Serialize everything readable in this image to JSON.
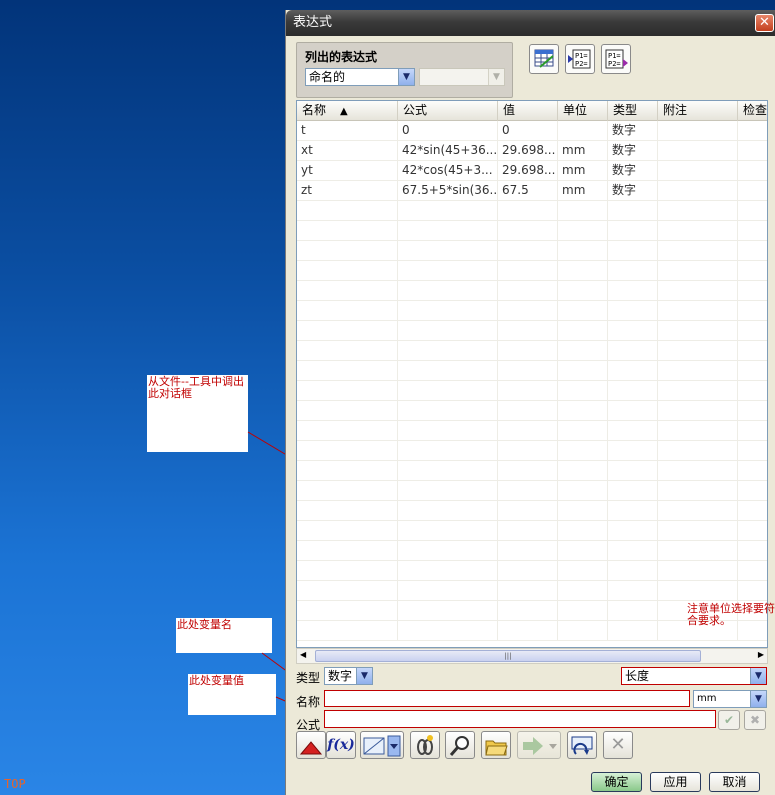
{
  "desktop": {
    "view_label": "TOP"
  },
  "annotations": {
    "dialog_source": "从文件--工具中调出此对话框",
    "var_name": "此处变量名",
    "var_value": "此处变量值",
    "unit_hint": "注意单位选择要符合要求。"
  },
  "dialog": {
    "title": "表达式",
    "close": "✕",
    "group_title": "列出的表达式",
    "list_filter": "命名的",
    "second_filter": "",
    "columns": [
      "名称",
      "公式",
      "值",
      "单位",
      "类型",
      "附注",
      "检查"
    ],
    "sort_indicator": "▲",
    "rows": [
      [
        "t",
        "0",
        "0",
        "",
        "数字",
        "",
        ""
      ],
      [
        "xt",
        "42*sin(45+36...",
        "29.698...",
        "mm",
        "数字",
        "",
        ""
      ],
      [
        "yt",
        "42*cos(45+3...",
        "29.698...",
        "mm",
        "数字",
        "",
        ""
      ],
      [
        "zt",
        "67.5+5*sin(36...",
        "67.5",
        "mm",
        "数字",
        "",
        ""
      ]
    ],
    "type_label": "类型",
    "type_value": "数字",
    "dimension_value": "长度",
    "name_label": "名称",
    "name_value": "",
    "unit_value": "mm",
    "formula_label": "公式",
    "formula_value": "",
    "ok": "确定",
    "apply": "应用",
    "cancel": "取消"
  },
  "colors": {
    "annotation": "#c00000",
    "title_bar": "#3a3a3a",
    "dialog_bg": "#ece9d8"
  }
}
